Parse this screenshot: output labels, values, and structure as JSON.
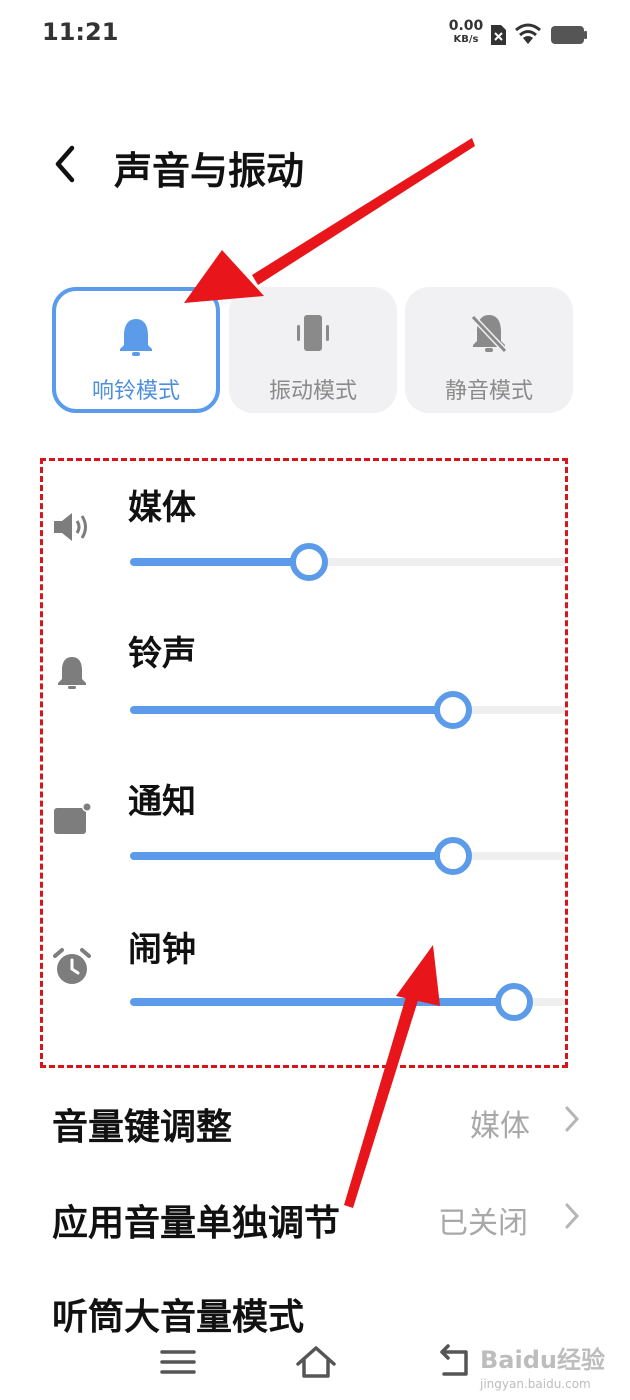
{
  "status_bar": {
    "time": "11:21",
    "net_speed_value": "0.00",
    "net_speed_unit": "KB/s",
    "icons": [
      "sim-disabled-icon",
      "wifi-icon",
      "battery-icon"
    ]
  },
  "header": {
    "title": "声音与振动",
    "back_icon": "chevron-left-icon"
  },
  "modes": [
    {
      "label": "响铃模式",
      "icon": "bell-icon",
      "active": true
    },
    {
      "label": "振动模式",
      "icon": "vibrate-icon",
      "active": false
    },
    {
      "label": "静音模式",
      "icon": "bell-off-icon",
      "active": false
    }
  ],
  "volume": {
    "sliders": [
      {
        "label": "媒体",
        "icon": "speaker-icon",
        "value": 0.41
      },
      {
        "label": "铃声",
        "icon": "bell-icon",
        "value": 0.74
      },
      {
        "label": "通知",
        "icon": "notification-icon",
        "value": 0.74
      },
      {
        "label": "闹钟",
        "icon": "alarm-clock-icon",
        "value": 0.88
      }
    ]
  },
  "settings": [
    {
      "label": "音量键调整",
      "value": "媒体"
    },
    {
      "label": "应用音量单独调节",
      "value": "已关闭"
    },
    {
      "label": "听筒大音量模式",
      "value": ""
    }
  ],
  "nav_bar": {
    "icons": [
      "menu-icon",
      "home-icon",
      "back-icon"
    ]
  },
  "watermark": {
    "text": "Baidu经验",
    "sub": "jingyan.baidu.com"
  },
  "colors": {
    "accent": "#5b9bea",
    "annotation_red": "#e8151b"
  }
}
